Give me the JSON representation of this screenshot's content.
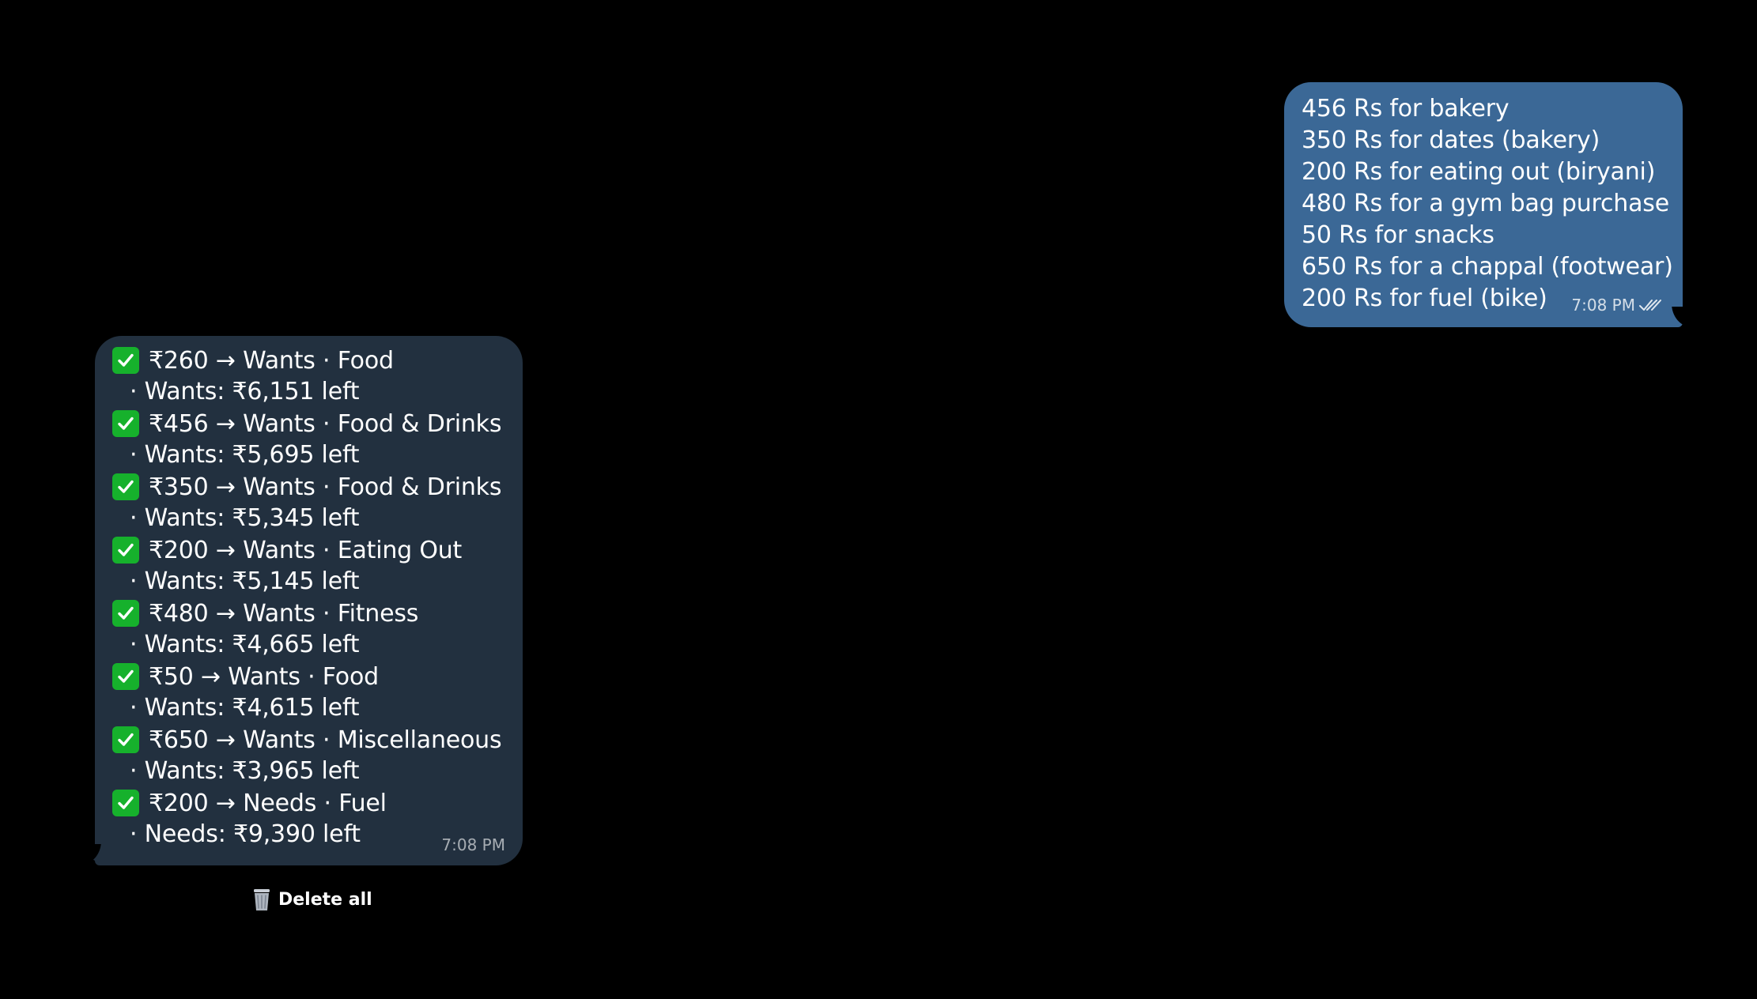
{
  "outgoing_message": {
    "lines": [
      "456 Rs for bakery",
      "350 Rs for dates (bakery)",
      "200 Rs for eating out (biryani)",
      "480 Rs for a gym bag purchase",
      "50 Rs for snacks",
      "650 Rs for a chappal (footwear)",
      "200 Rs for fuel (bike)"
    ],
    "time": "7:08 PM",
    "status_icon": "double-check-icon"
  },
  "incoming_message": {
    "entries": [
      {
        "main": "₹260 → Wants · Food",
        "sub": "· Wants: ₹6,151 left"
      },
      {
        "main": "₹456 → Wants · Food & Drinks",
        "sub": "· Wants: ₹5,695 left"
      },
      {
        "main": "₹350 → Wants · Food & Drinks",
        "sub": "· Wants: ₹5,345 left"
      },
      {
        "main": "₹200 → Wants · Eating Out",
        "sub": "· Wants: ₹5,145 left"
      },
      {
        "main": "₹480 → Wants · Fitness",
        "sub": "· Wants: ₹4,665 left"
      },
      {
        "main": "₹50 → Wants · Food",
        "sub": "· Wants: ₹4,615 left"
      },
      {
        "main": "₹650 → Wants · Miscellaneous",
        "sub": "· Wants: ₹3,965 left"
      },
      {
        "main": "₹200 → Needs · Fuel",
        "sub": "· Needs: ₹9,390 left"
      }
    ],
    "time": "7:08 PM",
    "entry_icon": "check-mark-button-icon"
  },
  "actions": {
    "delete_all_label": "Delete all",
    "delete_all_icon": "wastebasket-icon"
  },
  "colors": {
    "background": "#000000",
    "outgoing_bubble": "#3b6896",
    "incoming_bubble": "#22303f",
    "check_green": "#16b12c"
  }
}
